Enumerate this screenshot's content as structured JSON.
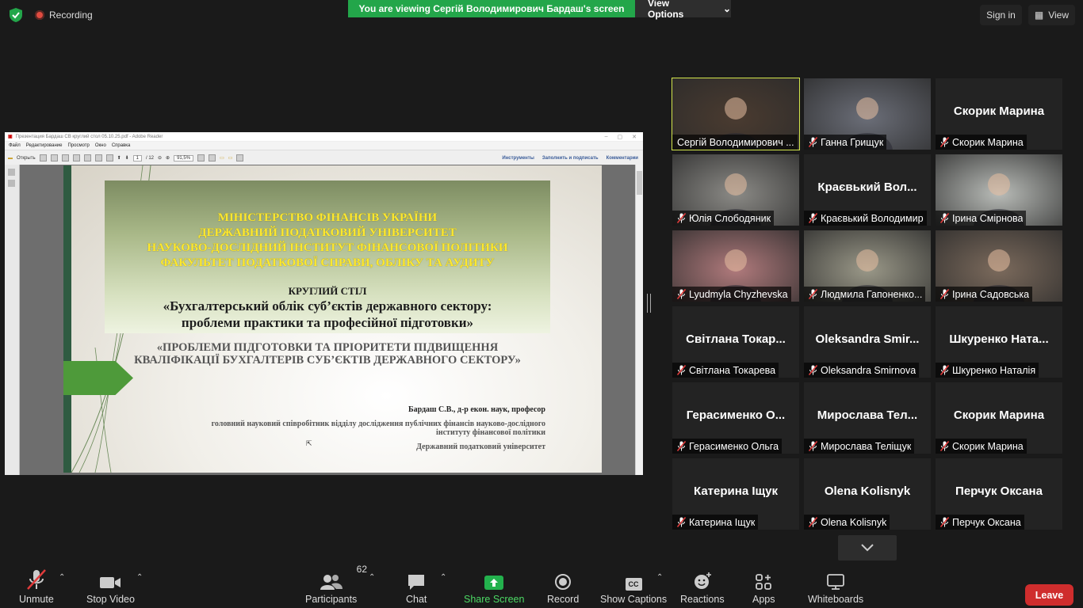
{
  "top": {
    "recording_label": "Recording",
    "banner": "You are viewing Сергій Володимирович Бардаш's screen",
    "view_options": "View Options",
    "sign_in": "Sign in",
    "view": "View"
  },
  "reader": {
    "title": "Презентация Бардаш СВ круглий стол 05.10.25.pdf - Adobe Reader",
    "menu": [
      "Файл",
      "Редактирование",
      "Просмотр",
      "Окно",
      "Справка"
    ],
    "open": "Открыть",
    "page_current": "1",
    "page_total": "/ 12",
    "zoom": "91,5%",
    "links": [
      "Инструменты",
      "Заполнить и подписать",
      "Комментарии"
    ]
  },
  "slide": {
    "heading_lines": [
      "МІНІСТЕРСТВО ФІНАНСІВ УКРАЇНИ",
      "ДЕРЖАВНИЙ ПОДАТКОВИЙ УНІВЕРСИТЕТ",
      "НАУКОВО-ДОСЛІДНИЙ ІНСТИТУТ ФІНАНСОВОЇ ПОЛІТИКИ",
      "ФАКУЛЬТЕТ ПОДАТКОВОЇ СПРАВИ, ОБЛІКУ ТА АУДИТУ"
    ],
    "event": "КРУГЛИЙ СТІЛ",
    "topic_line1": "«Бухгалтерський облік суб’єктів державного сектору:",
    "topic_line2": "проблеми практики та професійної підготовки»",
    "talk_line1": "«ПРОБЛЕМИ ПІДГОТОВКИ ТА ПРІОРИТЕТИ ПІДВИЩЕННЯ",
    "talk_line2": "КВАЛІФІКАЦІЇ БУХГАЛТЕРІВ СУБ’ЄКТІВ ДЕРЖАВНОГО СЕКТОРУ»",
    "author": "Бардаш С.В., д-р екон. наук, професор",
    "position_line1": "головний науковий співробітник відділу дослідження публічних фінансів науково-дослідного",
    "position_line2": "інституту фінансової політики",
    "institution": "Державний податковий університет"
  },
  "participants": [
    {
      "name": "Сергій Володимирович ...",
      "display": "",
      "video": true,
      "color": "#4a3b30",
      "muted": false,
      "active": true
    },
    {
      "name": "Ганна Грищук",
      "display": "",
      "video": true,
      "color": "#6b6e78",
      "muted": true
    },
    {
      "name": "Скорик Марина",
      "display": "Скорик Марина",
      "video": false,
      "muted": true
    },
    {
      "name": "Юлія Слободяник",
      "display": "",
      "video": true,
      "color": "#8b8a86",
      "muted": true
    },
    {
      "name": "Краєвький Володимир",
      "display": "Краєвький Вол...",
      "video": false,
      "muted": true
    },
    {
      "name": "Ірина Смірнова",
      "display": "",
      "video": true,
      "color": "#b9bcb8",
      "muted": true
    },
    {
      "name": "Lyudmyla Chyzhevska",
      "display": "",
      "video": true,
      "color": "#b07a7c",
      "muted": true
    },
    {
      "name": "Людмила Гапоненко...",
      "display": "",
      "video": true,
      "color": "#9a9888",
      "muted": true
    },
    {
      "name": "Ірина Садовська",
      "display": "",
      "video": true,
      "color": "#7b6a5c",
      "muted": true
    },
    {
      "name": "Світлана Токарева",
      "display": "Світлана Токар...",
      "video": false,
      "muted": true
    },
    {
      "name": "Oleksandra Smirnova",
      "display": "Oleksandra Smir...",
      "video": false,
      "muted": true
    },
    {
      "name": "Шкуренко Наталія",
      "display": "Шкуренко Ната...",
      "video": false,
      "muted": true
    },
    {
      "name": "Герасименко Ольга",
      "display": "Герасименко О...",
      "video": false,
      "muted": true
    },
    {
      "name": "Мирослава Теліщук",
      "display": "Мирослава Тел...",
      "video": false,
      "muted": true
    },
    {
      "name": "Скорик Марина",
      "display": "Скорик Марина",
      "video": false,
      "muted": true
    },
    {
      "name": "Катерина Іщук",
      "display": "Катерина Іщук",
      "video": false,
      "muted": true
    },
    {
      "name": "Olena Kolisnyk",
      "display": "Olena Kolisnyk",
      "video": false,
      "muted": true
    },
    {
      "name": "Перчук Оксана",
      "display": "Перчук Оксана",
      "video": false,
      "muted": true
    }
  ],
  "toolbar": {
    "unmute": "Unmute",
    "stop_video": "Stop Video",
    "participants": "Participants",
    "participants_count": "62",
    "chat": "Chat",
    "share_screen": "Share Screen",
    "record": "Record",
    "show_captions": "Show Captions",
    "captions_badge": "CC",
    "reactions": "Reactions",
    "apps": "Apps",
    "whiteboards": "Whiteboards",
    "leave": "Leave"
  }
}
